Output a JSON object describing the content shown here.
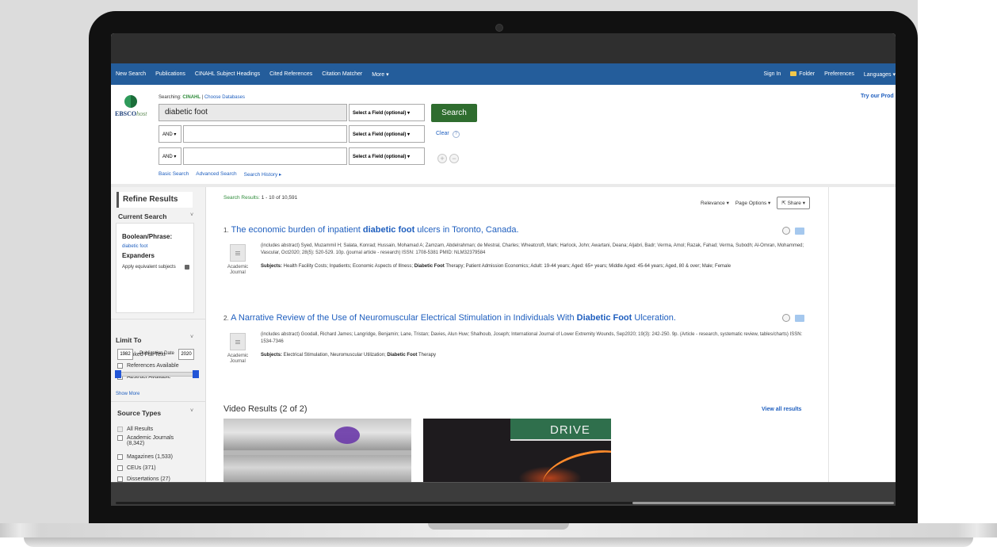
{
  "nav": {
    "left": [
      "New Search",
      "Publications",
      "CINAHL Subject Headings",
      "Cited References",
      "Citation Matcher",
      "More ▾"
    ],
    "sign_in": "Sign In",
    "folder": "Folder",
    "preferences": "Preferences",
    "languages": "Languages ▾"
  },
  "search": {
    "logo_ebsco": "EBSCO",
    "logo_host": "host",
    "searching_label": "Searching:",
    "database": "CINAHL",
    "separator": "|",
    "choose_db": "Choose Databases",
    "query": "diabetic foot",
    "field_select": "Select a Field (optional) ▾",
    "bool": "AND ▾",
    "search_button": "Search",
    "clear": "Clear",
    "help": "?",
    "plus": "+",
    "minus": "−",
    "basic": "Basic Search",
    "advanced": "Advanced Search",
    "history": "Search History ▸",
    "try": "Try our Prod"
  },
  "sidebar": {
    "refine": "Refine Results",
    "current_search": "Current Search",
    "boolean": "Boolean/Phrase:",
    "boolean_val": "diabetic foot",
    "expanders": "Expanders",
    "apply": "Apply equivalent subjects",
    "limit_to": "Limit To",
    "caret": "˅",
    "limits": [
      "Linked Full Text",
      "References Available",
      "Abstract Available"
    ],
    "year_from": "1982",
    "year_to": "2020",
    "pub_date": "Publication Date",
    "show_more": "Show More",
    "source_types": "Source Types",
    "sources": [
      "All Results",
      "Academic Journals (8,342)",
      "Magazines (1,533)",
      "CEUs (371)",
      "Dissertations (27)"
    ]
  },
  "results": {
    "count_label": "Search Results:",
    "count_value": "1 - 10 of 10,591",
    "relevance": "Relevance ▾",
    "page_options": "Page Options ▾",
    "share": "Share ▾",
    "items": [
      {
        "num": "1.",
        "title_pre": "The economic burden of inpatient ",
        "title_bold": "diabetic foot",
        "title_post": " ulcers in Toronto, Canada.",
        "desc": "(includes abstract) Syed, Muzammil H; Salata, Konrad; Hussain, Mohamad A; Zamzam, Abdelrahman; de Mestral, Charles; Wheatcroft, Mark; Harlock, John; Awartani, Deana; Aljabri, Badr; Verma, Amol; Razak, Fahad; Verma, Subodh; Al-Omran, Mohammed; Vascular, Oct2020; 28(5): 520-529. 10p. (journal article - research) ISSN: 1708-5381 PMID: NLM32379584",
        "subj_label": "Subjects:",
        "subj_pre": " Health Facility Costs; Inpatients; Economic Aspects of Illness; ",
        "subj_bold": "Diabetic Foot",
        "subj_post": " Therapy; Patient Admission Economics; Adult: 19-44 years; Aged: 65+ years; Middle Aged: 45-64 years; Aged, 80 & over; Male; Female",
        "type": "Academic Journal"
      },
      {
        "num": "2.",
        "title_pre": "A Narrative Review of the Use of Neuromuscular Electrical Stimulation in Individuals With ",
        "title_bold": "Diabetic Foot",
        "title_post": " Ulceration.",
        "desc": "(includes abstract) Goodall, Richard James; Langridge, Benjamin; Lane, Tristan; Davies, Alun Huw; Shalhoub, Joseph; International Journal of Lower Extremity Wounds, Sep2020; 19(3): 242-250. 9p. (Article - research, systematic review, tables/charts) ISSN: 1534-7346",
        "subj_label": "Subjects:",
        "subj_pre": " Electrical Stimulation, Neuromuscular Utilization; ",
        "subj_bold": "Diabetic Foot",
        "subj_post": " Therapy",
        "type": "Academic Journal"
      }
    ],
    "video_title": "Video Results (2 of 2)",
    "view_all": "View all results",
    "video_sign": "DRIVE"
  }
}
